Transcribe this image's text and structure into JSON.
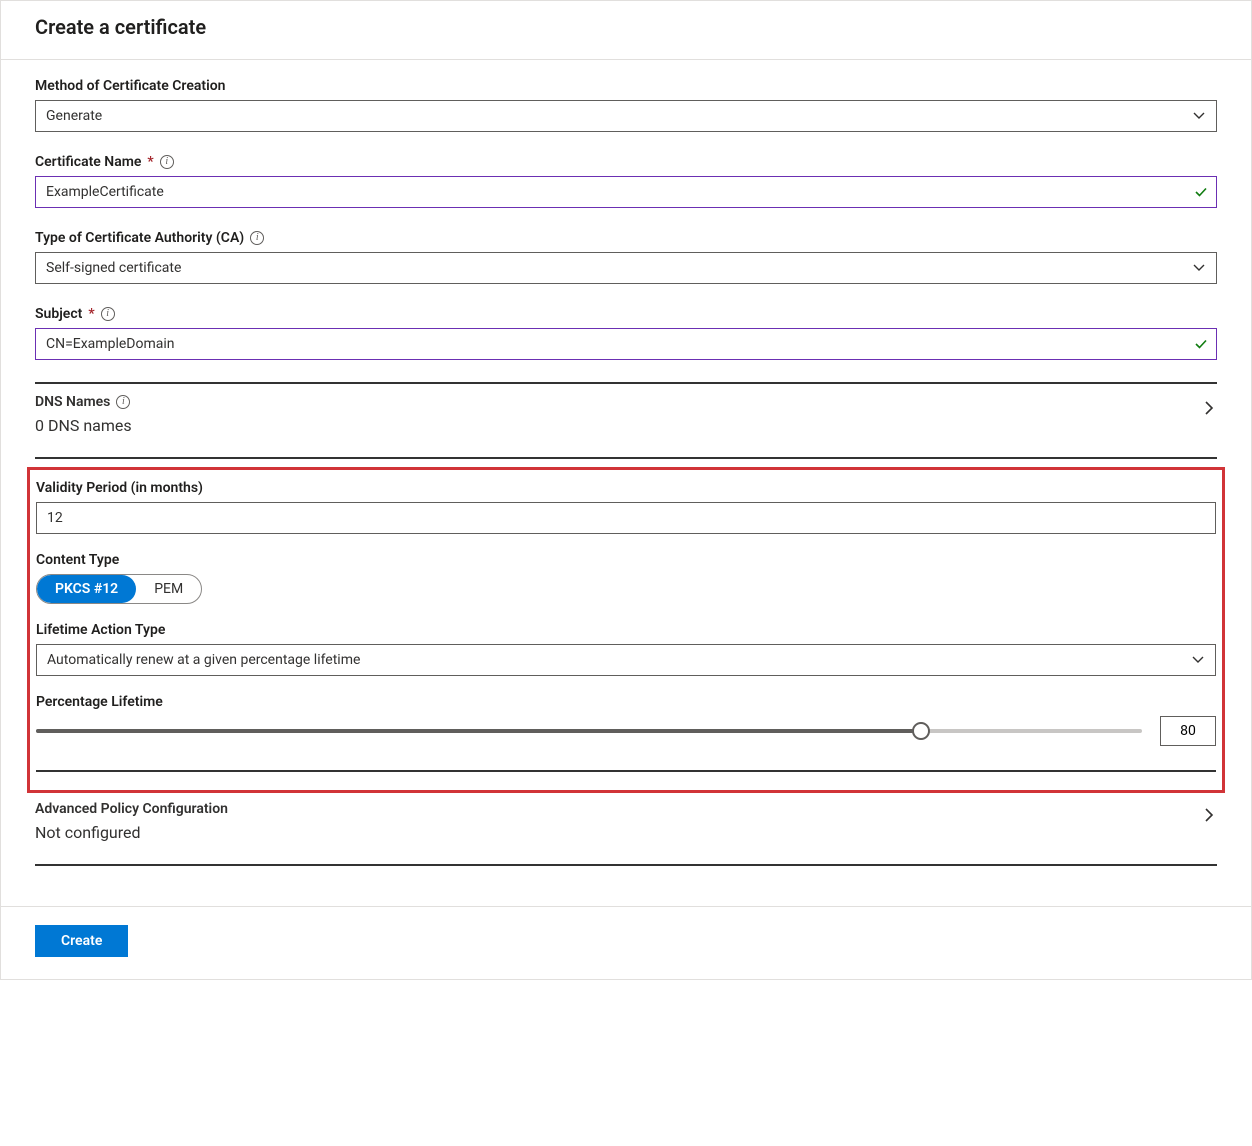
{
  "page_title": "Create a certificate",
  "fields": {
    "method": {
      "label": "Method of Certificate Creation",
      "value": "Generate"
    },
    "name": {
      "label": "Certificate Name",
      "value": "ExampleCertificate",
      "required": "*"
    },
    "ca_type": {
      "label": "Type of Certificate Authority (CA)",
      "value": "Self-signed certificate"
    },
    "subject": {
      "label": "Subject",
      "value": "CN=ExampleDomain",
      "required": "*"
    },
    "dns": {
      "label": "DNS Names",
      "value": "0 DNS names"
    },
    "validity": {
      "label": "Validity Period (in months)",
      "value": "12"
    },
    "content_type": {
      "label": "Content Type",
      "opt_a": "PKCS #12",
      "opt_b": "PEM"
    },
    "lifetime_action": {
      "label": "Lifetime Action Type",
      "value": "Automatically renew at a given percentage lifetime"
    },
    "percentage": {
      "label": "Percentage Lifetime",
      "value": "80"
    },
    "advanced": {
      "label": "Advanced Policy Configuration",
      "value": "Not configured"
    }
  },
  "buttons": {
    "create": "Create"
  }
}
